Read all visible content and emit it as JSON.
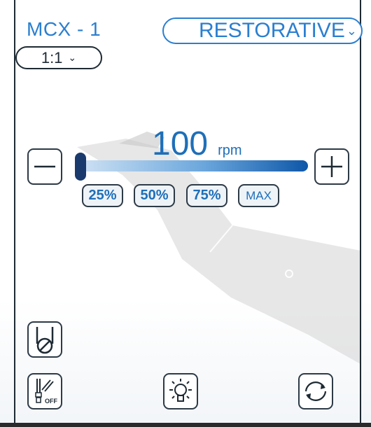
{
  "header": {
    "device_label": "MCX - 1",
    "mode": {
      "label": "RESTORATIVE",
      "chevron_icon": "chevron-down-icon"
    },
    "ratio": {
      "label": "1:1",
      "chevron_icon": "chevron-down-icon"
    }
  },
  "speed": {
    "value": "100",
    "unit": "rpm",
    "level": 0.0
  },
  "controls": {
    "decrease_icon": "minus-icon",
    "increase_icon": "plus-icon",
    "presets": [
      "25%",
      "50%",
      "75%",
      "MAX"
    ]
  },
  "bottom_icons": [
    "bur-icon",
    "spray-off-icon",
    "light-bulb-icon",
    "rotation-icon"
  ],
  "colors": {
    "accent": "#2a7fd0",
    "speed_text": "#1e6fb8",
    "thumb": "#1a3a6e",
    "border": "#2d3a46"
  }
}
